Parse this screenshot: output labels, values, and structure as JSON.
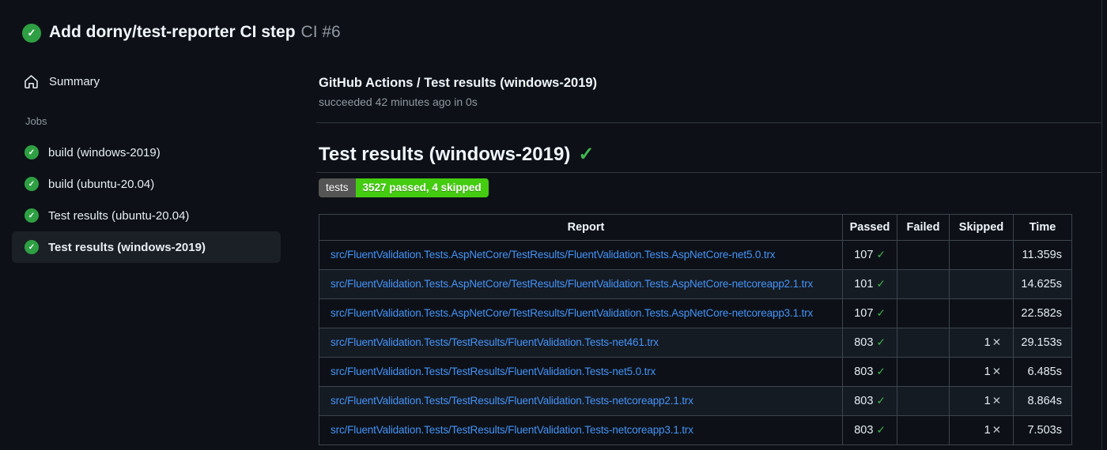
{
  "header": {
    "title": "Add dorny/test-reporter CI step",
    "run_number": "CI #6"
  },
  "sidebar": {
    "summary_label": "Summary",
    "jobs_label": "Jobs",
    "jobs": [
      {
        "label": "build (windows-2019)",
        "status": "success",
        "selected": false
      },
      {
        "label": "build (ubuntu-20.04)",
        "status": "success",
        "selected": false
      },
      {
        "label": "Test results (ubuntu-20.04)",
        "status": "success",
        "selected": false
      },
      {
        "label": "Test results (windows-2019)",
        "status": "success",
        "selected": true
      }
    ]
  },
  "main": {
    "workflow_title": "GitHub Actions / Test results (windows-2019)",
    "workflow_status": "succeeded 42 minutes ago in 0s",
    "heading": "Test results (windows-2019)",
    "heading_check": "✓",
    "badge": {
      "label": "tests",
      "value": "3527 passed, 4 skipped",
      "label_bg": "#555555",
      "value_bg": "#44cc11"
    },
    "table": {
      "columns": [
        "Report",
        "Passed",
        "Failed",
        "Skipped",
        "Time"
      ],
      "rows": [
        {
          "report": "src/FluentValidation.Tests.AspNetCore/TestResults/FluentValidation.Tests.AspNetCore-net5.0.trx",
          "passed": "107",
          "failed": "",
          "skipped": "",
          "time": "11.359s"
        },
        {
          "report": "src/FluentValidation.Tests.AspNetCore/TestResults/FluentValidation.Tests.AspNetCore-netcoreapp2.1.trx",
          "passed": "101",
          "failed": "",
          "skipped": "",
          "time": "14.625s"
        },
        {
          "report": "src/FluentValidation.Tests.AspNetCore/TestResults/FluentValidation.Tests.AspNetCore-netcoreapp3.1.trx",
          "passed": "107",
          "failed": "",
          "skipped": "",
          "time": "22.582s"
        },
        {
          "report": "src/FluentValidation.Tests/TestResults/FluentValidation.Tests-net461.trx",
          "passed": "803",
          "failed": "",
          "skipped": "1",
          "time": "29.153s"
        },
        {
          "report": "src/FluentValidation.Tests/TestResults/FluentValidation.Tests-net5.0.trx",
          "passed": "803",
          "failed": "",
          "skipped": "1",
          "time": "6.485s"
        },
        {
          "report": "src/FluentValidation.Tests/TestResults/FluentValidation.Tests-netcoreapp2.1.trx",
          "passed": "803",
          "failed": "",
          "skipped": "1",
          "time": "8.864s"
        },
        {
          "report": "src/FluentValidation.Tests/TestResults/FluentValidation.Tests-netcoreapp3.1.trx",
          "passed": "803",
          "failed": "",
          "skipped": "1",
          "time": "7.503s"
        }
      ]
    }
  },
  "icons": {
    "check": "✓",
    "cross": "✕"
  }
}
